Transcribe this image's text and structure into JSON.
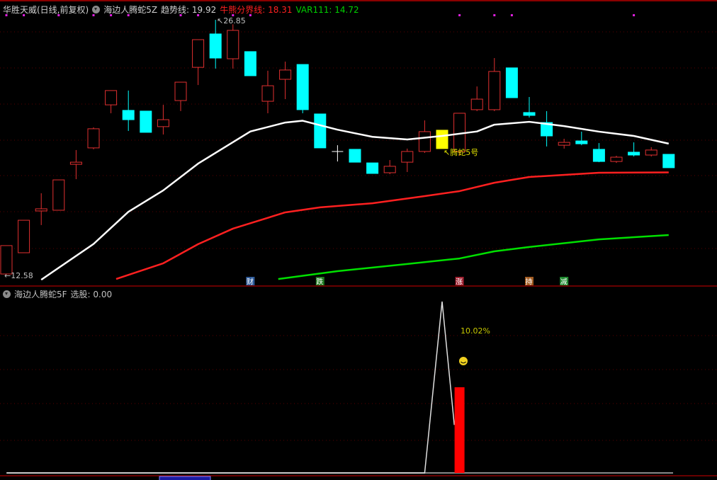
{
  "header": {
    "stock": "华胜天威(日线,前复权)",
    "indicator": "海边人腾蛇5Z",
    "trend_label": "趋势线: 19.92",
    "bull_bear_label": "牛熊分界线: 18.31",
    "var_label": "VAR111: 14.72"
  },
  "lower_header": {
    "indicator": "海边人腾蛇5F",
    "select_label": "选股: 0.00"
  },
  "colors": {
    "up": "#e03030",
    "down": "#00ffff",
    "trend": "#ffffff",
    "bull_bear": "#ff2020",
    "var": "#00e000",
    "highlight": "#ffff00",
    "grid": "#8b0000"
  },
  "annotations": {
    "high": "26.85",
    "low": "12.58",
    "signal": "腾蛇5号",
    "percent": "10.02%"
  },
  "markers": [
    {
      "index": 14,
      "text": "财",
      "color": "#2d5a9a"
    },
    {
      "index": 18,
      "text": "跌",
      "color": "#1f7a1f"
    },
    {
      "index": 26,
      "text": "涨",
      "color": "#a02030"
    },
    {
      "index": 30,
      "text": "持",
      "color": "#a05a20"
    },
    {
      "index": 32,
      "text": "减",
      "color": "#1f8a2f"
    }
  ],
  "dots": [
    0,
    1,
    3,
    5,
    6,
    7,
    10,
    11,
    13,
    14,
    26,
    28,
    29,
    36
  ],
  "chart_data": {
    "type": "candlestick",
    "candles": [
      [
        12.62,
        14.21,
        12.58,
        14.21
      ],
      [
        13.81,
        15.63,
        13.81,
        15.63
      ],
      [
        16.15,
        17.14,
        15.36,
        16.27
      ],
      [
        16.19,
        17.89,
        16.19,
        17.89
      ],
      [
        18.76,
        19.56,
        17.93,
        18.88
      ],
      [
        19.68,
        20.83,
        19.6,
        20.75
      ],
      [
        22.09,
        22.89,
        21.62,
        22.89
      ],
      [
        21.78,
        22.89,
        20.63,
        21.26
      ],
      [
        21.74,
        21.74,
        20.55,
        20.55
      ],
      [
        20.87,
        22.09,
        20.43,
        21.26
      ],
      [
        22.33,
        23.36,
        21.74,
        23.36
      ],
      [
        24.19,
        25.74,
        23.2,
        25.74
      ],
      [
        26.06,
        26.85,
        24.12,
        24.71
      ],
      [
        24.67,
        26.6,
        24.12,
        26.26
      ],
      [
        25.07,
        25.07,
        23.72,
        23.72
      ],
      [
        22.29,
        24.0,
        21.62,
        23.16
      ],
      [
        23.52,
        24.51,
        22.41,
        24.04
      ],
      [
        24.35,
        24.35,
        21.62,
        21.82
      ],
      [
        21.58,
        21.58,
        19.68,
        19.68
      ],
      [
        19.48,
        19.83,
        18.92,
        19.48
      ],
      [
        19.6,
        19.6,
        18.88,
        18.88
      ],
      [
        18.84,
        18.84,
        18.25,
        18.25
      ],
      [
        18.29,
        19.0,
        18.21,
        18.65
      ],
      [
        18.88,
        19.64,
        18.33,
        19.48
      ],
      [
        19.48,
        21.22,
        19.4,
        20.59
      ],
      [
        19.64,
        20.67,
        19.64,
        20.67
      ],
      [
        19.48,
        21.62,
        19.24,
        21.62
      ],
      [
        21.82,
        23.12,
        21.74,
        22.41
      ],
      [
        21.82,
        24.71,
        21.74,
        23.96
      ],
      [
        24.16,
        24.16,
        22.49,
        22.49
      ],
      [
        21.66,
        22.53,
        21.38,
        21.5
      ],
      [
        21.1,
        21.74,
        19.76,
        20.35
      ],
      [
        19.83,
        20.19,
        19.64,
        19.99
      ],
      [
        20.07,
        20.59,
        19.83,
        19.91
      ],
      [
        19.6,
        19.95,
        18.88,
        18.92
      ],
      [
        18.92,
        19.24,
        18.84,
        19.16
      ],
      [
        19.44,
        19.99,
        19.2,
        19.28
      ],
      [
        19.28,
        19.72,
        19.2,
        19.56
      ],
      [
        19.32,
        19.32,
        18.57,
        18.57
      ]
    ],
    "candle_fields": [
      "open",
      "high",
      "low",
      "close"
    ],
    "highlight_index": 25,
    "series": [
      {
        "name": "趋势线",
        "points": [
          [
            2,
            12.3
          ],
          [
            5,
            14.3
          ],
          [
            7,
            16.1
          ],
          [
            9,
            17.3
          ],
          [
            11,
            18.8
          ],
          [
            13,
            20.0
          ],
          [
            14,
            20.6
          ],
          [
            16,
            21.1
          ],
          [
            17,
            21.2
          ],
          [
            19,
            20.7
          ],
          [
            21,
            20.3
          ],
          [
            23,
            20.15
          ],
          [
            25,
            20.35
          ],
          [
            27,
            20.6
          ],
          [
            28,
            20.98
          ],
          [
            30,
            21.14
          ],
          [
            32,
            20.9
          ],
          [
            34,
            20.59
          ],
          [
            36,
            20.35
          ],
          [
            38,
            19.92
          ]
        ]
      },
      {
        "name": "牛熊分界线",
        "points": [
          [
            6.3,
            12.34
          ],
          [
            9,
            13.22
          ],
          [
            11,
            14.29
          ],
          [
            13,
            15.16
          ],
          [
            16,
            16.07
          ],
          [
            18,
            16.35
          ],
          [
            21,
            16.58
          ],
          [
            24,
            16.98
          ],
          [
            26,
            17.26
          ],
          [
            28,
            17.73
          ],
          [
            30,
            18.05
          ],
          [
            34,
            18.29
          ],
          [
            38,
            18.31
          ]
        ]
      },
      {
        "name": "VAR111",
        "points": [
          [
            15.6,
            12.34
          ],
          [
            19,
            12.78
          ],
          [
            23,
            13.18
          ],
          [
            26,
            13.49
          ],
          [
            28,
            13.89
          ],
          [
            30,
            14.13
          ],
          [
            34,
            14.56
          ],
          [
            38,
            14.8
          ]
        ]
      }
    ],
    "lower": {
      "line": [
        [
          0,
          0
        ],
        [
          24,
          0
        ],
        [
          25,
          1.0
        ],
        [
          25.7,
          0.28
        ]
      ],
      "bar": {
        "index": 26,
        "value": 0.5
      }
    }
  }
}
